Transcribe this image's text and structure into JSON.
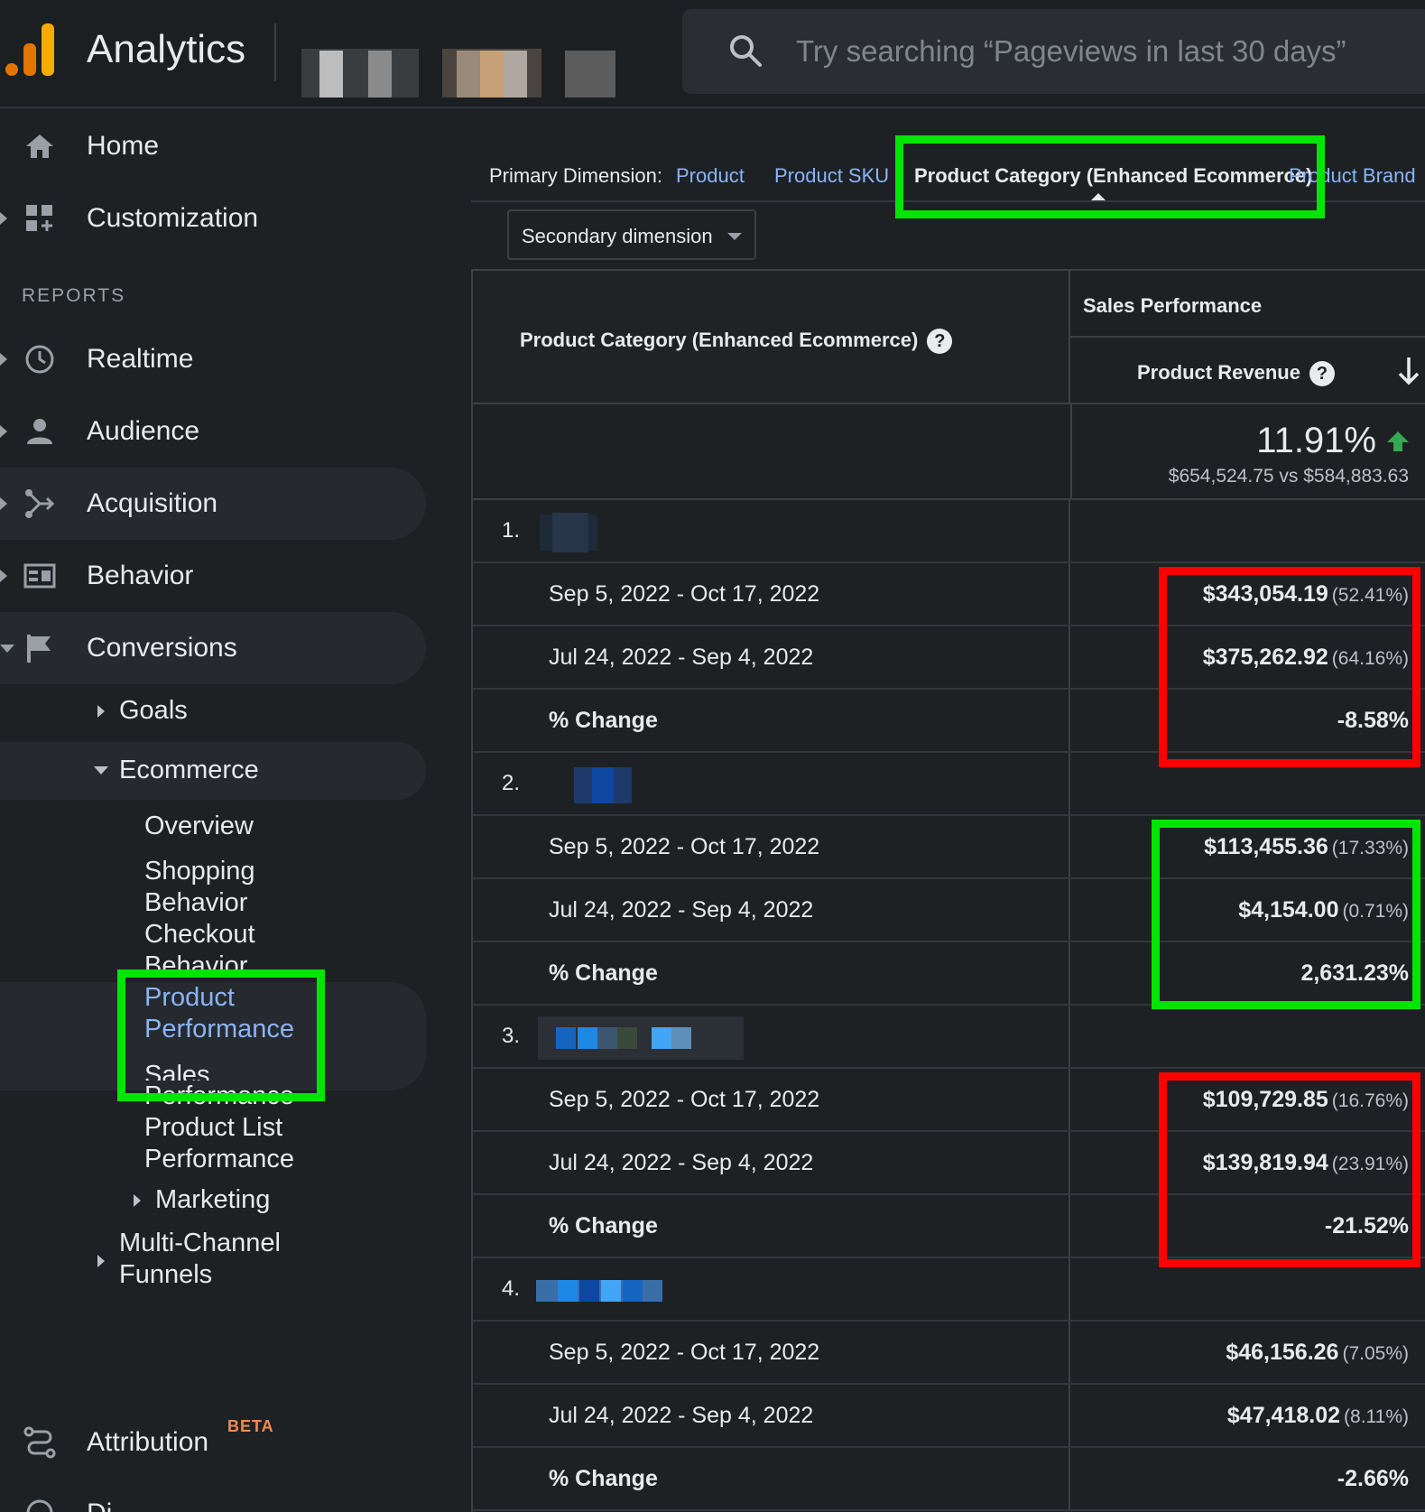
{
  "app": {
    "title": "Analytics"
  },
  "search": {
    "placeholder": "Try searching “Pageviews in last 30 days”"
  },
  "nav": {
    "home": "Home",
    "customization": "Customization",
    "reports_section": "REPORTS",
    "realtime": "Realtime",
    "audience": "Audience",
    "acquisition": "Acquisition",
    "behavior": "Behavior",
    "conversions": "Conversions",
    "goals": "Goals",
    "ecommerce": "Ecommerce",
    "overview": "Overview",
    "shopping_behavior_1": "Shopping",
    "shopping_behavior_2": "Behavior",
    "checkout_behavior_1": "Checkout",
    "checkout_behavior_2": "Behavior",
    "product_performance_1": "Product",
    "product_performance_2": "Performance",
    "sales_performance_1": "Sales",
    "sales_performance_2": "Performance",
    "product_list_1": "Product List",
    "product_list_2": "Performance",
    "marketing": "Marketing",
    "multichannel_1": "Multi-Channel",
    "multichannel_2": "Funnels",
    "attribution": "Attribution",
    "attribution_badge": "BETA",
    "discover_partial": "Di"
  },
  "dimension": {
    "label": "Primary Dimension:",
    "options": [
      "Product",
      "Product SKU",
      "Product Category (Enhanced Ecommerce)",
      "Product Brand"
    ],
    "selected": "Product Category (Enhanced Ecommerce)",
    "secondary": "Secondary dimension"
  },
  "table": {
    "col_dimension": "Product Category (Enhanced Ecommerce)",
    "group_header": "Sales Performance",
    "col_metric": "Product Revenue",
    "summary": {
      "pct": "11.91%",
      "compare": "$654,524.75 vs $584,883.63"
    },
    "rows": [
      {
        "rank": "1.",
        "date1": "Sep 5, 2022 - Oct 17, 2022",
        "value1": "$343,054.19",
        "share1": "(52.41%)",
        "date2": "Jul 24, 2022 - Sep 4, 2022",
        "value2": "$375,262.92",
        "share2": "(64.16%)",
        "change_label": "% Change",
        "change": "-8.58%"
      },
      {
        "rank": "2.",
        "date1": "Sep 5, 2022 - Oct 17, 2022",
        "value1": "$113,455.36",
        "share1": "(17.33%)",
        "date2": "Jul 24, 2022 - Sep 4, 2022",
        "value2": "$4,154.00",
        "share2": "(0.71%)",
        "change_label": "% Change",
        "change": "2,631.23%"
      },
      {
        "rank": "3.",
        "date1": "Sep 5, 2022 - Oct 17, 2022",
        "value1": "$109,729.85",
        "share1": "(16.76%)",
        "date2": "Jul 24, 2022 - Sep 4, 2022",
        "value2": "$139,819.94",
        "share2": "(23.91%)",
        "change_label": "% Change",
        "change": "-21.52%"
      },
      {
        "rank": "4.",
        "date1": "Sep 5, 2022 - Oct 17, 2022",
        "value1": "$46,156.26",
        "share1": "(7.05%)",
        "date2": "Jul 24, 2022 - Sep 4, 2022",
        "value2": "$47,418.02",
        "share2": "(8.11%)",
        "change_label": "% Change",
        "change": "-2.66%"
      }
    ]
  },
  "colors": {
    "highlight_green": "#00e600",
    "highlight_red": "#ff0000",
    "link": "#8ab4f8",
    "logo": "#f9ab00"
  }
}
